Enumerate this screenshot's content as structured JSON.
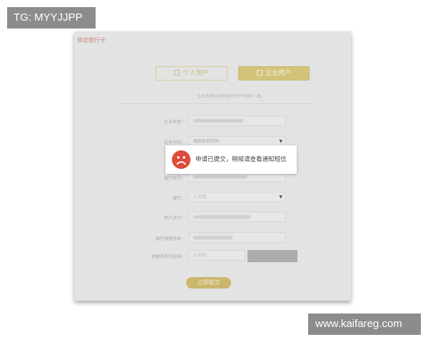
{
  "watermarks": {
    "top_left": "TG: MYYJJPP",
    "bottom_right": "www.kaifareg.com"
  },
  "dialog": {
    "title": "绑定银行卡",
    "tabs": [
      {
        "label": "个人用户",
        "icon": "person-card-icon",
        "active": false
      },
      {
        "label": "企业用户",
        "icon": "building-icon",
        "active": true
      }
    ],
    "notice": "企业名称必须和银行开户名称一致。"
  },
  "form": {
    "company_name": {
      "label": "企业名称："
    },
    "id_type": {
      "label": "证件号码：",
      "value": "组织机构代码"
    },
    "bank_account": {
      "label": "银行账号："
    },
    "bank": {
      "label": "银行：",
      "value": "上海银"
    },
    "branch": {
      "label": "开户支行："
    },
    "bank_phone": {
      "label": "银行预留手机："
    },
    "sms_code": {
      "label": "预留手机验证码：",
      "value": "上海银"
    },
    "submit_label": "立即提交"
  },
  "toast": {
    "message": "申请已提交，稍候请查看通知短信",
    "icon": "sad-face-icon",
    "icon_color": "#df4a3b"
  },
  "colors": {
    "accent_gold": "#d3c37a",
    "card_bg": "#e3e3e3"
  }
}
